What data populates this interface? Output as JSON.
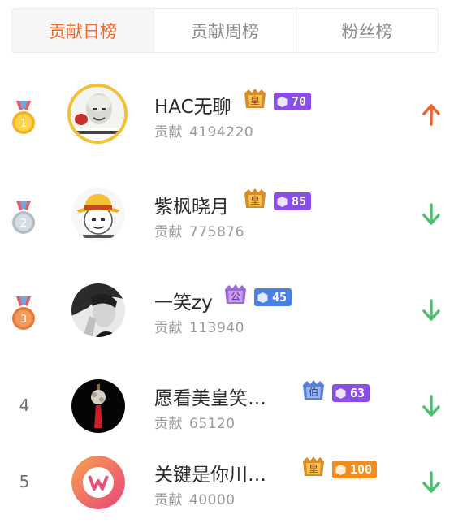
{
  "tabs": [
    {
      "label": "贡献日榜",
      "active": true
    },
    {
      "label": "贡献周榜",
      "active": false
    },
    {
      "label": "粉丝榜",
      "active": false
    }
  ],
  "colors": {
    "accent": "#ec6a2a",
    "up": "#f0622b",
    "down": "#4fbf6e",
    "purple_badge": "#8a4de8",
    "blue_badge": "#4a7fe6",
    "orange_badge": "#f48b1c",
    "gold": "#f2c138"
  },
  "contribution_label": "贡献",
  "ranking": [
    {
      "rank": "1",
      "name": "HAC无聊",
      "contribution": "4194220",
      "crown": "皇",
      "level": "70",
      "level_color": "purple",
      "trend": "up",
      "medal": "gold",
      "avatar": "meme-face"
    },
    {
      "rank": "2",
      "name": "紫枫晓月",
      "contribution": "775876",
      "crown": "皇",
      "level": "85",
      "level_color": "purple",
      "trend": "down",
      "medal": "silver",
      "avatar": "straw-hat-meme"
    },
    {
      "rank": "3",
      "name": "一笑zy",
      "contribution": "113940",
      "crown": "公",
      "level": "45",
      "level_color": "blue",
      "trend": "down",
      "medal": "bronze",
      "avatar": "bw-portrait"
    },
    {
      "rank": "4",
      "name": "愿看美皇笑…",
      "contribution": "65120",
      "crown": "伯",
      "level": "63",
      "level_color": "purple",
      "trend": "down",
      "medal": "none",
      "avatar": "tassel-ornament"
    },
    {
      "rank": "5",
      "name": "关键是你川…",
      "contribution": "40000",
      "crown": "皇",
      "level": "100",
      "level_color": "orange",
      "trend": "down",
      "medal": "none",
      "avatar": "pink-logo"
    }
  ]
}
